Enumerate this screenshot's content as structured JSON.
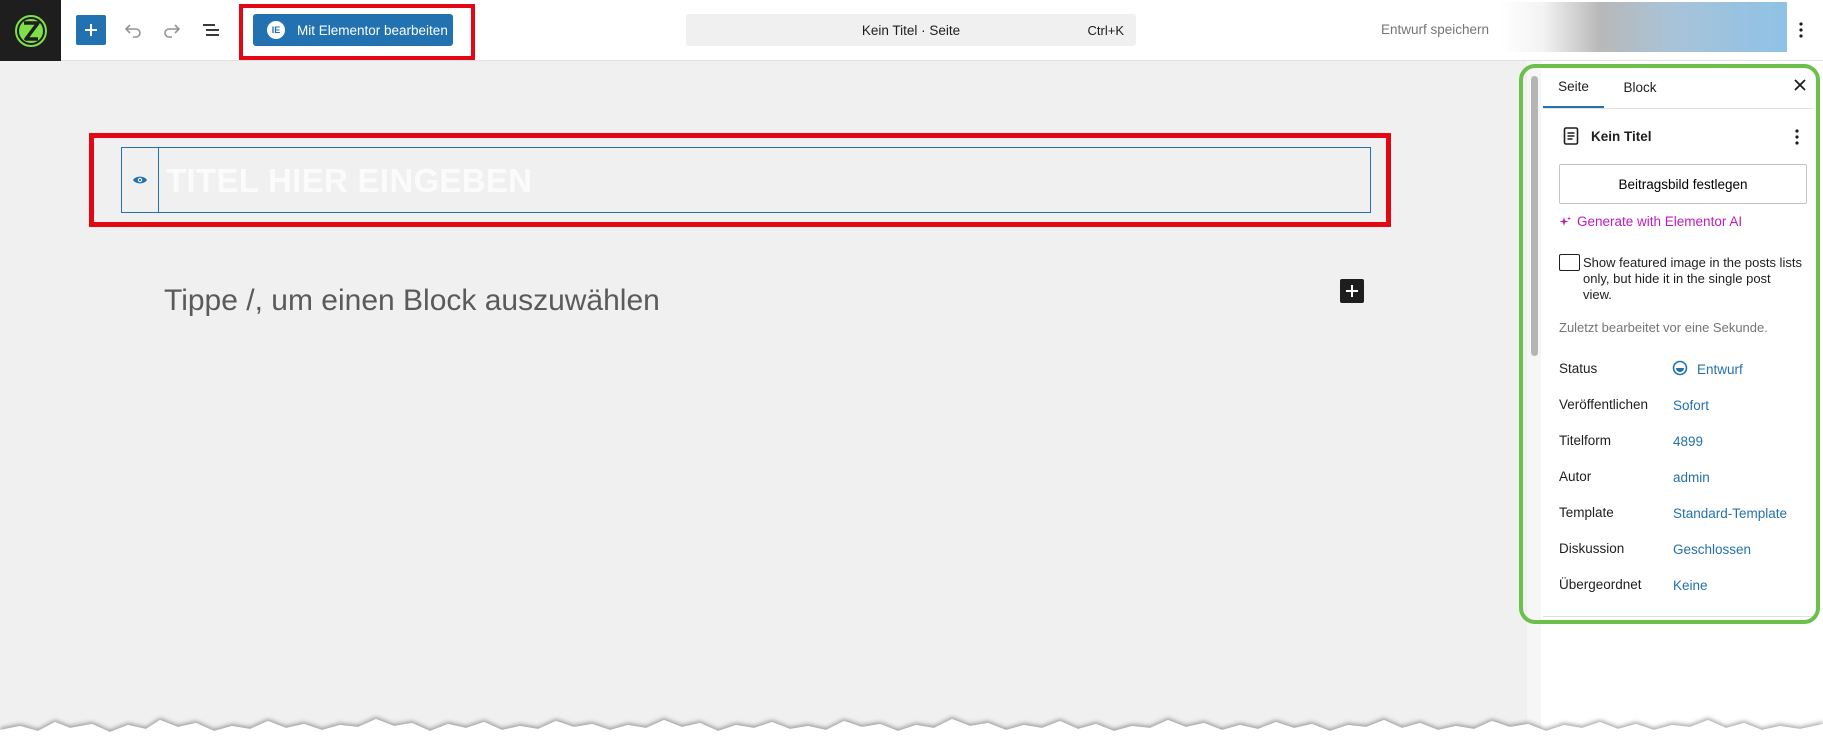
{
  "topbar": {
    "elementor_button": "Mit Elementor bearbeiten",
    "elementor_mark": "IE",
    "command_title": "Kein Titel · Seite",
    "command_shortcut": "Ctrl+K",
    "save_draft": "Entwurf speichern"
  },
  "canvas": {
    "title_placeholder": "TITEL HIER EINGEBEN",
    "block_placeholder": "Tippe /, um einen Block auszuwählen"
  },
  "sidebar": {
    "tabs": [
      {
        "label": "Seite"
      },
      {
        "label": "Block"
      }
    ],
    "doc_title": "Kein Titel",
    "featured_image_button": "Beitragsbild festlegen",
    "ai_link": "Generate with Elementor AI",
    "checkbox_label": "Show featured image in the posts lists only, but hide it in the single post view.",
    "last_edited": "Zuletzt bearbeitet vor eine Sekunde.",
    "meta": [
      {
        "label": "Status",
        "value": "Entwurf"
      },
      {
        "label": "Veröffentlichen",
        "value": "Sofort"
      },
      {
        "label": "Titelform",
        "value": "4899"
      },
      {
        "label": "Autor",
        "value": "admin"
      },
      {
        "label": "Template",
        "value": "Standard-Template"
      },
      {
        "label": "Diskussion",
        "value": "Geschlossen"
      },
      {
        "label": "Übergeordnet",
        "value": "Keine"
      }
    ]
  },
  "colors": {
    "accent": "#2271b1",
    "highlight_red": "#e30613",
    "highlight_green": "#6cc04a",
    "ai_magenta": "#c11bbd",
    "logo_green": "#7ee04a"
  },
  "icons": [
    "site-logo-icon",
    "plus-icon",
    "undo-icon",
    "redo-icon",
    "list-view-icon",
    "eye-icon",
    "close-icon",
    "page-icon",
    "more-vertical-icon",
    "sparkle-icon",
    "draft-status-icon"
  ]
}
